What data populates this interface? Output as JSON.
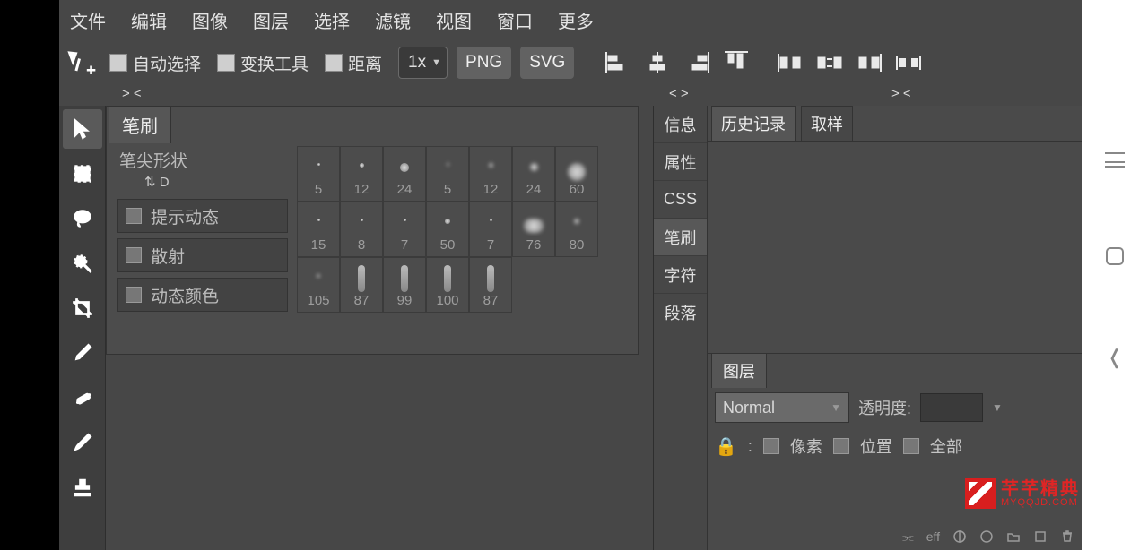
{
  "menu": [
    "文件",
    "编辑",
    "图像",
    "图层",
    "选择",
    "滤镜",
    "视图",
    "窗口",
    "更多"
  ],
  "options": {
    "auto_select": "自动选择",
    "transform_tools": "变换工具",
    "distance": "距离",
    "zoom": "1x",
    "fmt_png": "PNG",
    "fmt_svg": "SVG"
  },
  "marks": {
    "left": "> <",
    "mid": "< >",
    "right": "> <"
  },
  "left_tools": [
    {
      "name": "move-tool",
      "active": true
    },
    {
      "name": "marquee-tool"
    },
    {
      "name": "lasso-tool"
    },
    {
      "name": "quick-select-tool"
    },
    {
      "name": "crop-tool"
    },
    {
      "name": "eyedropper-tool"
    },
    {
      "name": "heal-tool"
    },
    {
      "name": "brush-tool"
    },
    {
      "name": "stamp-tool"
    }
  ],
  "brush_panel": {
    "tab": "笔刷",
    "tip_shape": "笔尖形状",
    "swap": "⇅",
    "d": "D",
    "opts": [
      "提示动态",
      "散射",
      "动态颜色"
    ],
    "tips": [
      [
        {
          "s": 3,
          "l": "5"
        },
        {
          "s": 5,
          "l": "12"
        },
        {
          "s": 10,
          "l": "24"
        },
        {
          "s": 2,
          "l": "5",
          "soft": true
        },
        {
          "s": 5,
          "l": "12",
          "soft": true
        },
        {
          "s": 9,
          "l": "24",
          "soft": true
        },
        {
          "s": 20,
          "l": "60",
          "soft": true
        }
      ],
      [
        {
          "s": 3,
          "l": "15"
        },
        {
          "s": 3,
          "l": "8"
        },
        {
          "s": 3,
          "l": "7"
        },
        {
          "s": 6,
          "l": "50"
        },
        {
          "s": 3,
          "l": "7"
        },
        {
          "s": 16,
          "l": "76",
          "soft": true,
          "blob": true
        },
        {
          "s": 6,
          "l": "80",
          "soft": true
        }
      ],
      [
        {
          "s": 4,
          "l": "105",
          "soft": true
        },
        {
          "stroke": true,
          "l": "87"
        },
        {
          "stroke": true,
          "l": "99"
        },
        {
          "stroke": true,
          "l": "100"
        },
        {
          "stroke": true,
          "l": "87"
        }
      ]
    ]
  },
  "right_tabs": [
    "信息",
    "属性",
    "CSS",
    "笔刷",
    "字符",
    "段落"
  ],
  "right_active_index": 3,
  "history": {
    "tab1": "历史记录",
    "tab2": "取样"
  },
  "layers": {
    "tab": "图层",
    "blend": "Normal",
    "opacity_label": "透明度:",
    "locks": {
      "pixel": "像素",
      "position": "位置",
      "all": "全部"
    },
    "footer": {
      "link": "⌘",
      "eff": "eff"
    }
  },
  "watermark": {
    "t1": "芊芊精典",
    "t2": "MYQQJD.COM"
  }
}
